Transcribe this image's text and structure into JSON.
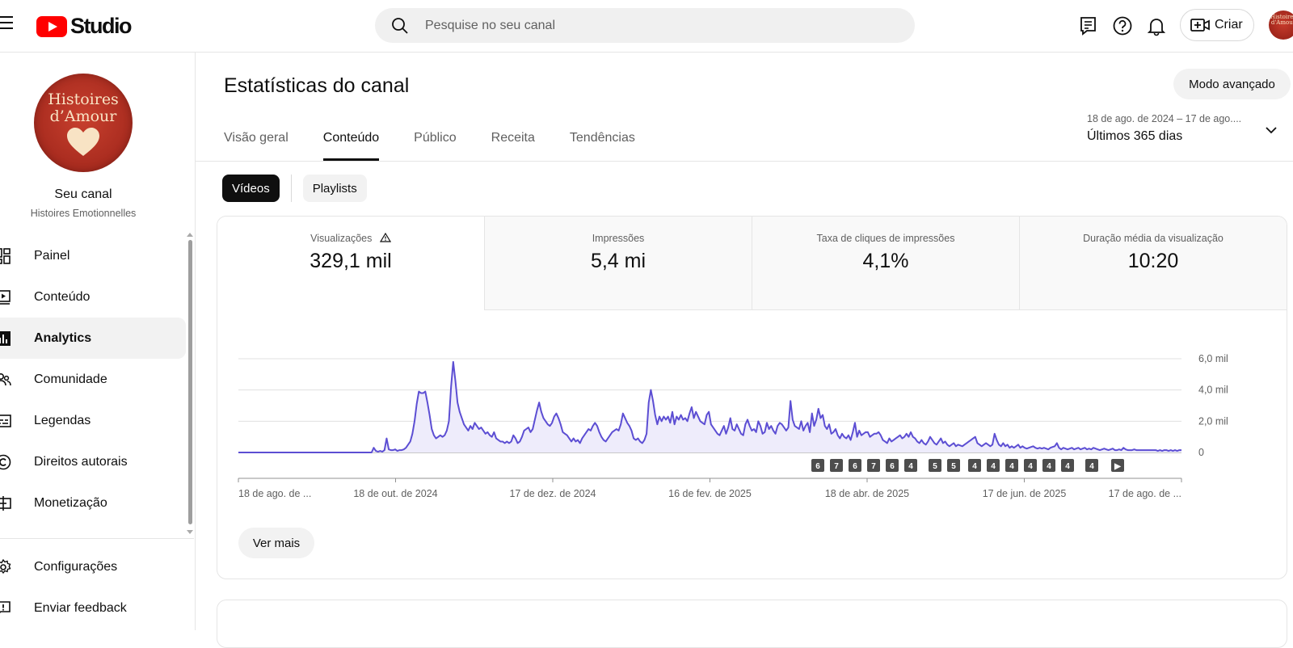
{
  "header": {
    "logo_text": "Studio",
    "search_placeholder": "Pesquise no seu canal",
    "create_label": "Criar",
    "avatar_text": "Histoires d'Amour"
  },
  "sidebar": {
    "avatar_line1": "Histoires",
    "avatar_line2": "d’Amour",
    "channel_title": "Seu canal",
    "channel_name": "Histoires Emotionnelles",
    "items": [
      {
        "label": "Painel",
        "icon": "dashboard-icon"
      },
      {
        "label": "Conteúdo",
        "icon": "content-icon"
      },
      {
        "label": "Analytics",
        "icon": "analytics-icon",
        "active": true
      },
      {
        "label": "Comunidade",
        "icon": "community-icon"
      },
      {
        "label": "Legendas",
        "icon": "subtitles-icon"
      },
      {
        "label": "Direitos autorais",
        "icon": "copyright-icon"
      },
      {
        "label": "Monetização",
        "icon": "monetization-icon"
      }
    ],
    "bottom_items": [
      {
        "label": "Configurações",
        "icon": "settings-icon"
      },
      {
        "label": "Enviar feedback",
        "icon": "feedback-icon"
      }
    ]
  },
  "main": {
    "title": "Estatísticas do canal",
    "advanced_mode": "Modo avançado",
    "tabs": [
      {
        "label": "Visão geral"
      },
      {
        "label": "Conteúdo",
        "active": true
      },
      {
        "label": "Público"
      },
      {
        "label": "Receita"
      },
      {
        "label": "Tendências"
      }
    ],
    "date_range": {
      "dates": "18 de ago. de 2024 – 17 de ago....",
      "label": "Últimos 365 dias"
    },
    "chips": [
      {
        "label": "Vídeos",
        "active": true
      },
      {
        "label": "Playlists"
      }
    ],
    "metrics": [
      {
        "title": "Visualizações",
        "value": "329,1 mil",
        "active": true
      },
      {
        "title": "Impressões",
        "value": "5,4 mi"
      },
      {
        "title": "Taxa de cliques de impressões",
        "value": "4,1%"
      },
      {
        "title": "Duração média da visualização",
        "value": "10:20"
      }
    ],
    "see_more": "Ver mais"
  },
  "chart_data": {
    "type": "line",
    "title": "",
    "xlabel": "",
    "ylabel": "",
    "x_tick_labels": [
      "18 de ago. de ...",
      "18 de out. de 2024",
      "17 de dez. de 2024",
      "16 de fev. de 2025",
      "18 de abr. de 2025",
      "17 de jun. de 2025",
      "17 de ago. de ..."
    ],
    "y_tick_labels": [
      "6,0 mil",
      "4,0 mil",
      "2,0 mil",
      "0"
    ],
    "ylim": [
      0,
      6000
    ],
    "grid": true,
    "color": "#5c4ed3",
    "fill_color": "#eeecfb",
    "series": [
      {
        "values": [
          0,
          0,
          0,
          0,
          0,
          0,
          0,
          0,
          0,
          0,
          0,
          0,
          0,
          0,
          0,
          0,
          0,
          0,
          0,
          0,
          0,
          0,
          0,
          0,
          0,
          0,
          0,
          0,
          0,
          0,
          0,
          0,
          0,
          0,
          0,
          0,
          0,
          0,
          0,
          0,
          0,
          0,
          0,
          0,
          0,
          0,
          0,
          0,
          0,
          0,
          0,
          0,
          0,
          0,
          0,
          0,
          0,
          0,
          0,
          0,
          0,
          0,
          0,
          300,
          100,
          50,
          100,
          50,
          150,
          900,
          200,
          150,
          150,
          200,
          100,
          150,
          150,
          200,
          300,
          500,
          700,
          1200,
          2000,
          3100,
          3900,
          3800,
          3800,
          3900,
          3200,
          2400,
          1500,
          1100,
          900,
          1000,
          1100,
          1000,
          1100,
          1400,
          2000,
          4200,
          5800,
          4600,
          3200,
          2600,
          2200,
          1800,
          1600,
          1400,
          1700,
          1500,
          1900,
          1700,
          1500,
          1600,
          1400,
          1200,
          1300,
          1100,
          1000,
          1300,
          900,
          800,
          700,
          700,
          600,
          700,
          600,
          700,
          1100,
          900,
          600,
          700,
          1000,
          1400,
          1500,
          1600,
          1300,
          1500,
          2100,
          2700,
          3200,
          2600,
          2200,
          2000,
          1800,
          1700,
          1900,
          2300,
          2500,
          2200,
          1800,
          1300,
          1200,
          1100,
          900,
          700,
          900,
          700,
          800,
          600,
          900,
          1100,
          1300,
          1500,
          1400,
          1700,
          1900,
          1700,
          1300,
          1000,
          800,
          700,
          900,
          1100,
          1300,
          1400,
          1500,
          1400,
          1800,
          2500,
          2200,
          1900,
          1700,
          1400,
          900,
          800,
          900,
          700,
          600,
          800,
          1200,
          3200,
          4000,
          3300,
          2400,
          1800,
          2300,
          2000,
          2300,
          2100,
          2300,
          1900,
          2600,
          1800,
          2300,
          2100,
          2400,
          2100,
          2200,
          2000,
          2500,
          2900,
          2200,
          2600,
          2300,
          2000,
          1900,
          1800,
          2400,
          2600,
          1800,
          1600,
          1400,
          1200,
          1100,
          1400,
          1700,
          1200,
          1600,
          2200,
          1500,
          1400,
          1800,
          1500,
          1200,
          1100,
          1800,
          2100,
          1700,
          1400,
          1500,
          1300,
          2000,
          1700,
          1200,
          1300,
          1900,
          1500,
          1700,
          1400,
          1200,
          1700,
          1900,
          1800,
          1600,
          1400,
          1600,
          3300,
          2100,
          1700,
          1600,
          1500,
          2000,
          1400,
          1700,
          1900,
          1300,
          2500,
          1700,
          2100,
          2800,
          2200,
          2400,
          1700,
          1500,
          1800,
          1200,
          1300,
          1500,
          1100,
          900,
          1200,
          1000,
          900,
          1100,
          800,
          1300,
          1900,
          1000,
          1400,
          1100,
          1200,
          1300,
          1300,
          1000,
          1100,
          1200,
          1200,
          1300,
          1100,
          800,
          700,
          600,
          900,
          700,
          800,
          900,
          1000,
          1100,
          900,
          1000,
          1200,
          1000,
          1300,
          1000,
          900,
          700,
          600,
          800,
          600,
          500,
          700,
          1000,
          800,
          600,
          500,
          700,
          900,
          600,
          700,
          500,
          400,
          500,
          600,
          400,
          500,
          450,
          400,
          500,
          600,
          700,
          800,
          900,
          1000,
          600,
          500,
          400,
          500,
          600,
          500,
          400,
          500,
          1200,
          800,
          500,
          400,
          600,
          400,
          500,
          300,
          400,
          300,
          400,
          500,
          300,
          400,
          300,
          250,
          300,
          350,
          400,
          300,
          250,
          300,
          250,
          300,
          250,
          200,
          300,
          350,
          400,
          600,
          300,
          200,
          300,
          250,
          200,
          250,
          300,
          200,
          250,
          300,
          200,
          250,
          300,
          200,
          250,
          200,
          300,
          250,
          200,
          150,
          200,
          250,
          200,
          150,
          200,
          250,
          150,
          150,
          200,
          150,
          300,
          200,
          150,
          150,
          150,
          200,
          150,
          150,
          150,
          150,
          150,
          150,
          150,
          150,
          150,
          150,
          100,
          150,
          100,
          150,
          150,
          100,
          150,
          100,
          150,
          100,
          150,
          150
        ]
      }
    ],
    "markers": [
      "6",
      "7",
      "6",
      "7",
      "6",
      "4",
      "5",
      "5",
      "4",
      "4",
      "4",
      "4",
      "4",
      "4",
      "4",
      "▶"
    ]
  }
}
